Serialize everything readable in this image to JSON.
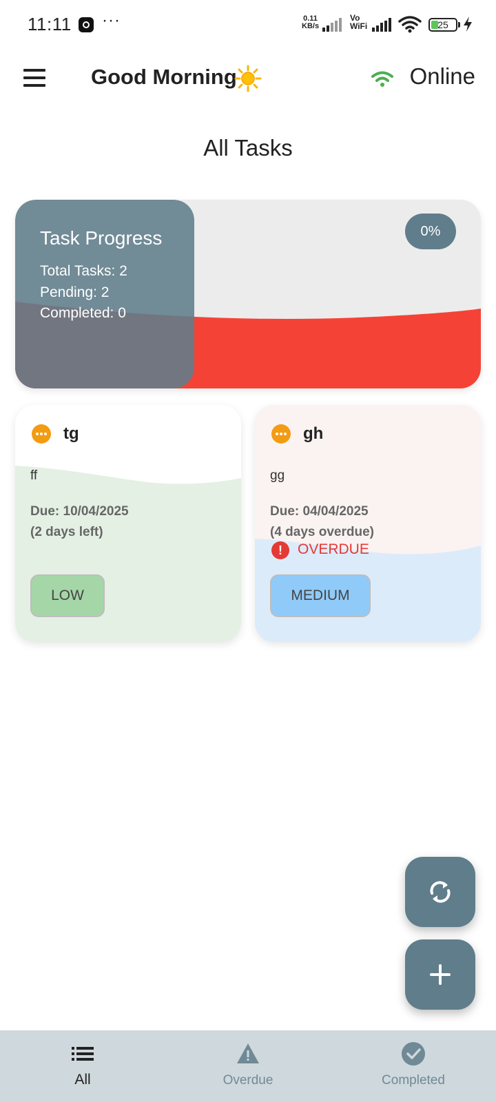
{
  "status_bar": {
    "time": "11:11",
    "dots": "···",
    "speed_value": "0.11",
    "speed_unit": "KB/s",
    "vowifi_top": "Vo",
    "vowifi_bottom": "WiFi",
    "battery": "25"
  },
  "app_bar": {
    "greeting": "Good Morning",
    "connection_status": "Online"
  },
  "page_title": "All Tasks",
  "progress": {
    "title": "Task Progress",
    "total": "Total Tasks: 2",
    "pending": "Pending: 2",
    "completed": "Completed: 0",
    "percent_label": "0%",
    "percent_value": 0
  },
  "tasks": [
    {
      "title": "tg",
      "description": "ff",
      "due": "Due: 10/04/2025",
      "remaining": "(2 days left)",
      "priority": "LOW",
      "status_icon": "pending-dots-icon"
    },
    {
      "title": "gh",
      "description": "gg",
      "due": "Due: 04/04/2025",
      "remaining": "(4 days overdue)",
      "overdue_label": "OVERDUE",
      "priority": "MEDIUM",
      "status_icon": "pending-dots-icon"
    }
  ],
  "fabs": {
    "sync_icon": "sync-icon",
    "add_icon": "add-icon"
  },
  "bottom_nav": {
    "items": [
      {
        "label": "All",
        "icon": "list-icon",
        "active": true
      },
      {
        "label": "Overdue",
        "icon": "warning-icon",
        "active": false
      },
      {
        "label": "Completed",
        "icon": "check-circle-icon",
        "active": false
      }
    ]
  },
  "colors": {
    "primary": "#607d8b",
    "accent_online": "#4caf50",
    "overdue": "#e53935",
    "pending": "#f39c12",
    "low_priority": "#a5d6a7",
    "medium_priority": "#90caf9",
    "progress_wave": "#f44336"
  }
}
